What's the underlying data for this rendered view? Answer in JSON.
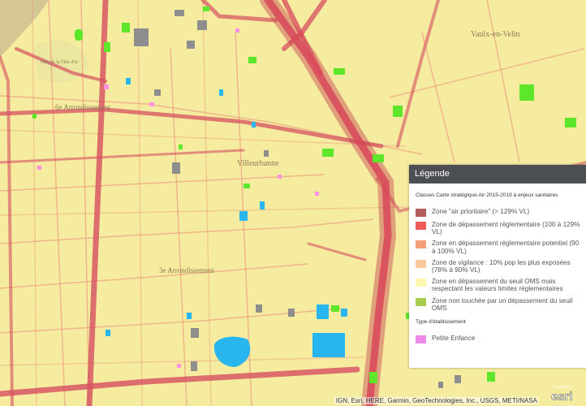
{
  "map": {
    "places": [
      "Vaulx-en-Velin",
      "Villeurbanne",
      "6e Arrondissement",
      "3e Arrondissement",
      "Parc de la Tête d'or"
    ],
    "colors": {
      "background": "#f6eca0",
      "major_road": "#d65060",
      "minor_road": "#e98a78",
      "green_zone": "#5ee62a",
      "blue_zone": "#29b6ee",
      "gray_building": "#8e8e8e",
      "pink_zone": "#ff8fe3"
    }
  },
  "legend": {
    "title": "Légende",
    "section_title": "Classes Carte stratégique Air 2015-2019 à enjeux sanitaires",
    "classes": [
      {
        "label": "Zone \"air prioritaire\" (> 129% VL)",
        "color": "#b45c5c"
      },
      {
        "label": "Zone de dépassement réglementaire (100 à 129% VL)",
        "color": "#ee5c58"
      },
      {
        "label": "Zone en dépassement réglementaire potentiel (90 à 100% VL)",
        "color": "#f5a07a"
      },
      {
        "label": "Zone de vigilance : 10% pop les plus exposées (78% à 90% VL)",
        "color": "#fbc79d"
      },
      {
        "label": "Zone en dépassement du seuil OMS mais respectant les valeurs limites réglementaires",
        "color": "#fef7b4"
      },
      {
        "label": "Zone non touchée par un dépassement du seuil OMS",
        "color": "#a8cc52"
      }
    ],
    "establishment_title": "Type d'établissement",
    "establishments": [
      {
        "label": "Petite Enfance",
        "color": "#f08ae8"
      }
    ]
  },
  "attribution": "IGN, Esri, HERE, Garmin, GeoTechnologies, Inc., USGS, METI/NASA",
  "logo": {
    "text": "esri",
    "caption": "POWERED BY"
  }
}
